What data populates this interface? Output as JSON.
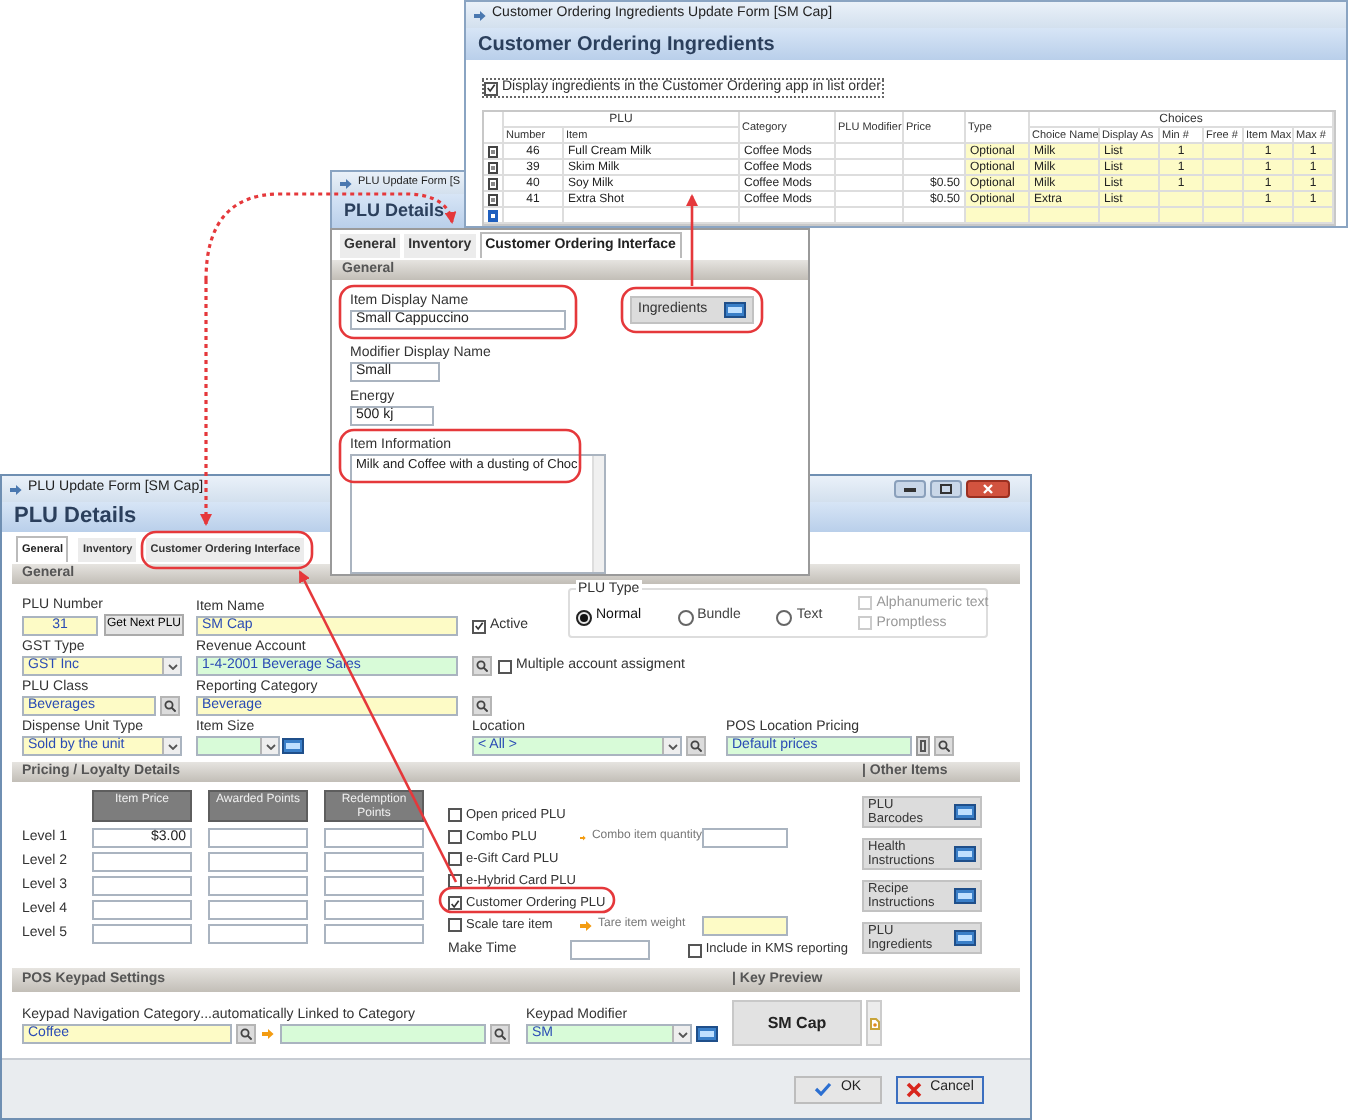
{
  "plu_form_behind": {
    "title": "PLU Update Form [S",
    "heading": "PLU Details"
  },
  "ingredients_window": {
    "title": "Customer Ordering Ingredients Update Form [SM Cap]",
    "heading": "Customer Ordering Ingredients",
    "list_order_checkbox": {
      "label": "Display ingredients in the Customer Ordering app in list order",
      "checked": true
    },
    "table": {
      "columns": [
        {
          "label": "Number",
          "group": "PLU"
        },
        {
          "label": "Item",
          "grouped": true
        },
        {
          "label": "Category"
        },
        {
          "label": "PLU Modifier"
        },
        {
          "label": "Price"
        },
        {
          "label": "Type"
        },
        {
          "label": "Choice Name",
          "group": "Choices"
        },
        {
          "label": "Display As",
          "grouped": true
        },
        {
          "label": "Min #",
          "grouped": true
        },
        {
          "label": "Free #",
          "grouped": true
        },
        {
          "label": "Item Max",
          "grouped": true
        },
        {
          "label": "Max #",
          "grouped": true
        }
      ],
      "rows": [
        {
          "cells": [
            "46",
            "Full Cream Milk",
            "Coffee Mods",
            null,
            null,
            "Optional",
            "Milk",
            "List",
            "1",
            null,
            "1",
            "1"
          ]
        },
        {
          "cells": [
            "39",
            "Skim Milk",
            "Coffee Mods",
            null,
            null,
            "Optional",
            "Milk",
            "List",
            "1",
            null,
            "1",
            "1"
          ]
        },
        {
          "cells": [
            "40",
            "Soy Milk",
            "Coffee Mods",
            null,
            "$0.50",
            "Optional",
            "Milk",
            "List",
            "1",
            null,
            "1",
            "1"
          ]
        },
        {
          "cells": [
            "41",
            "Extra Shot",
            "Coffee Mods",
            null,
            "$0.50",
            "Optional",
            "Extra",
            "List",
            null,
            null,
            "1",
            "1"
          ]
        }
      ]
    }
  },
  "plu_form": {
    "title": "PLU Update Form [SM Cap]",
    "heading": "PLU Details",
    "tabs": [
      {
        "label": "General",
        "selected": true
      },
      {
        "label": "Inventory",
        "selected": false
      },
      {
        "label": "Customer Ordering Interface",
        "selected": false
      }
    ],
    "general": {
      "section_title": "General",
      "plu_number": {
        "label": "PLU Number",
        "value": "31"
      },
      "get_next_plu_button": "Get Next PLU",
      "item_name": {
        "label": "Item Name",
        "value": "SM Cap"
      },
      "active": {
        "label": "Active",
        "checked": true
      },
      "plu_type": {
        "legend": "PLU Type",
        "options": [
          {
            "label": "Normal",
            "selected": true
          },
          {
            "label": "Bundle",
            "selected": false
          },
          {
            "label": "Text",
            "selected": false
          }
        ],
        "flags": [
          {
            "label": "Alphanumeric text",
            "checked": false,
            "disabled": true
          },
          {
            "label": "Promptless",
            "checked": false,
            "disabled": true
          }
        ]
      },
      "gst_type": {
        "label": "GST Type",
        "value": "GST Inc"
      },
      "revenue_account": {
        "label": "Revenue Account",
        "value": "1-4-2001  Beverage Sales"
      },
      "multiple_account": {
        "label": "Multiple account assigment",
        "checked": false
      },
      "plu_class": {
        "label": "PLU Class",
        "value": "Beverages"
      },
      "reporting_category": {
        "label": "Reporting Category",
        "value": "Beverage"
      },
      "dispense_unit_type": {
        "label": "Dispense Unit Type",
        "value": "Sold by the unit"
      },
      "item_size": {
        "label": "Item Size"
      },
      "location": {
        "label": "Location",
        "value": "< All >"
      },
      "pos_location_pricing": {
        "label": "POS Location Pricing",
        "value": "Default prices"
      }
    },
    "pricing": {
      "section_title": "Pricing / Loyalty Details",
      "columns": [
        "Item Price",
        "Awarded Points",
        "Redemption Points"
      ],
      "levels": [
        {
          "label": "Level 1",
          "item_price": "$3.00"
        },
        {
          "label": "Level 2"
        },
        {
          "label": "Level 3"
        },
        {
          "label": "Level 4"
        },
        {
          "label": "Level 5"
        }
      ],
      "options": [
        {
          "label": "Open priced PLU",
          "checked": false
        },
        {
          "label": "Combo PLU",
          "checked": false,
          "field": {
            "label": "Combo item quantity"
          }
        },
        {
          "label": "e-Gift Card PLU",
          "checked": false
        },
        {
          "label": "e-Hybrid Card PLU",
          "checked": false
        },
        {
          "label": "Customer Ordering PLU",
          "checked": true
        },
        {
          "label": "Scale tare item",
          "checked": false,
          "field": {
            "label": "Tare item weight"
          }
        }
      ],
      "make_time": {
        "label": "Make Time"
      },
      "kms": {
        "label": "Include in KMS reporting",
        "checked": false
      }
    },
    "other_items": {
      "section_title": "| Other Items",
      "buttons": [
        "PLU Barcodes",
        "Health Instructions",
        "Recipe Instructions",
        "PLU Ingredients"
      ]
    },
    "keypad": {
      "section_title": "POS Keypad Settings",
      "navigation_category": {
        "label": "Keypad Navigation Category",
        "value": "Coffee"
      },
      "linked_category": {
        "label": "...automatically Linked to Category"
      },
      "keypad_modifier": {
        "label": "Keypad Modifier",
        "value": "SM"
      }
    },
    "key_preview": {
      "section_title": "| Key Preview",
      "key_label": "SM Cap"
    },
    "footer_buttons": [
      "OK",
      "Cancel"
    ]
  },
  "customer_ordering_panel": {
    "tabs": [
      {
        "label": "General",
        "selected": false
      },
      {
        "label": "Inventory",
        "selected": false
      },
      {
        "label": "Customer Ordering Interface",
        "selected": true
      }
    ],
    "section_title": "General",
    "item_display_name": {
      "label": "Item Display Name",
      "value": "Small Cappuccino"
    },
    "modifier_display_name": {
      "label": "Modifier Display Name",
      "value": "Small"
    },
    "energy": {
      "label": "Energy",
      "value": "500 kj"
    },
    "item_information": {
      "label": "Item Information",
      "value": "Milk and Coffee with a dusting of Choc"
    },
    "ingredients_button": "Ingredients"
  }
}
